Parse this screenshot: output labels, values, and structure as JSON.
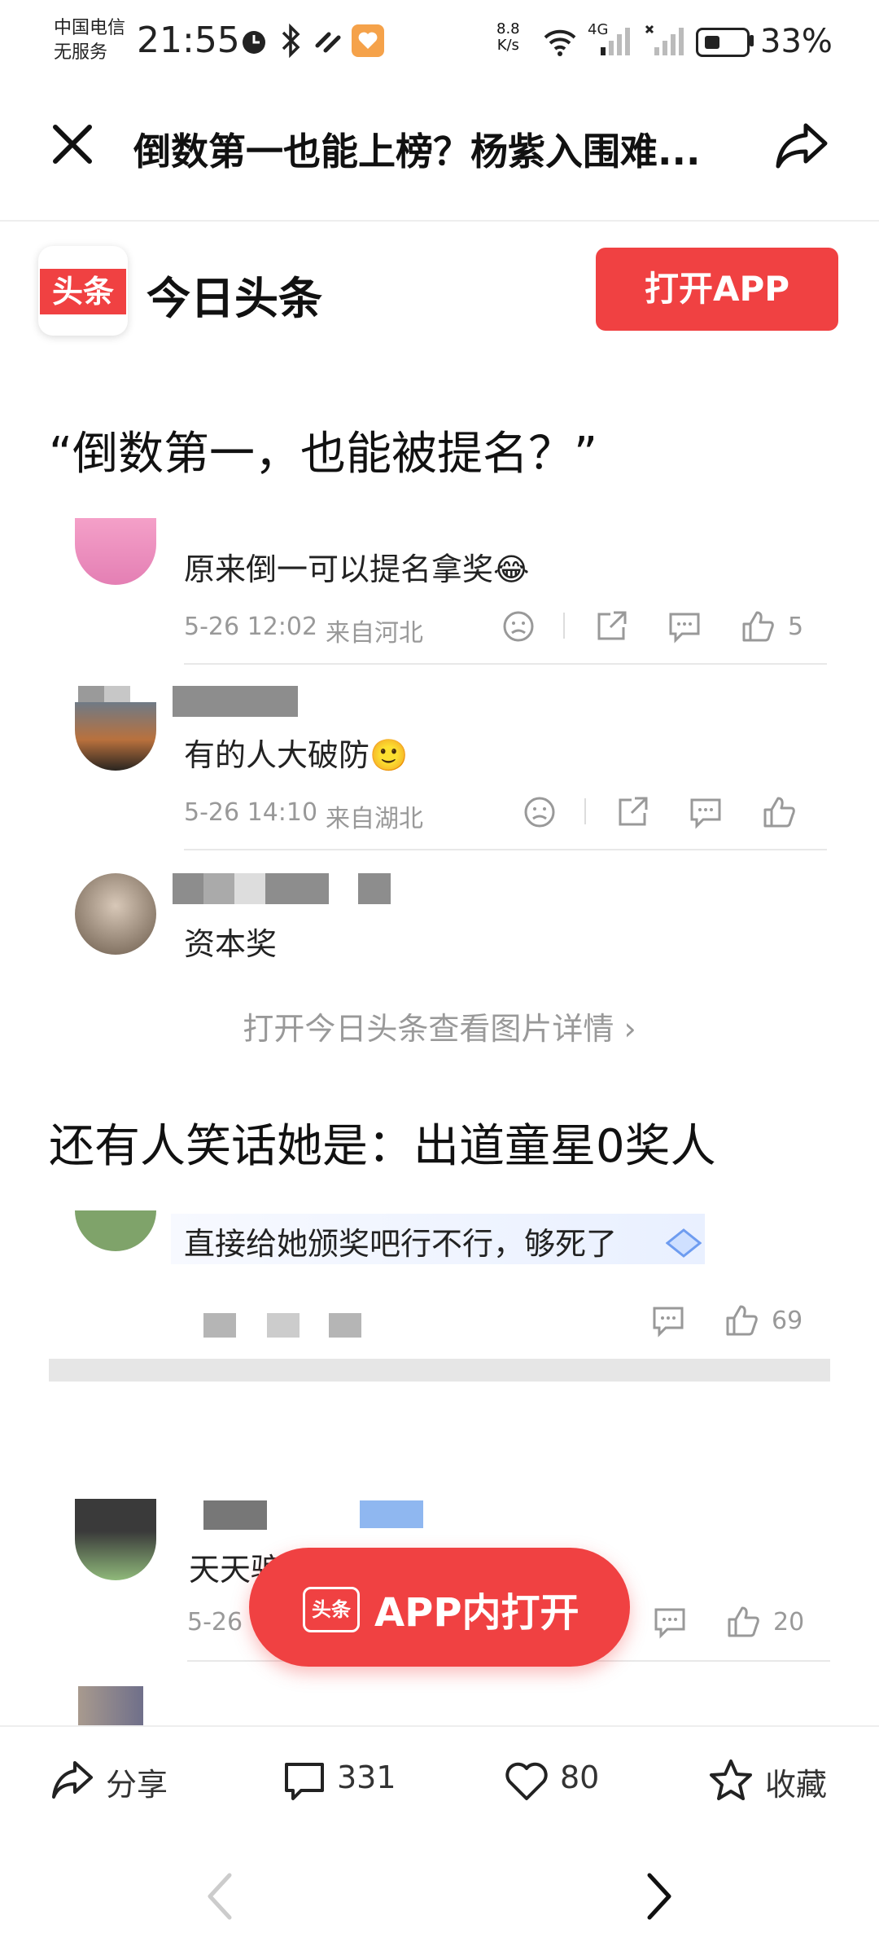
{
  "status_bar": {
    "carrier_line1": "中国电信",
    "carrier_line2": "无服务",
    "time": "21:55",
    "net_speed_value": "8.8",
    "net_speed_unit": "K/s",
    "network": "4G",
    "battery_percent": "33%",
    "battery_level": 0.33
  },
  "nav": {
    "title": "倒数第一也能上榜？杨紫入围难..."
  },
  "app_banner": {
    "logo_text": "头条",
    "app_name": "今日头条",
    "open_button": "打开APP"
  },
  "section1": {
    "heading": "“倒数第一，也能被提名？”",
    "comments": [
      {
        "text": "原来倒一可以提名拿奖😂",
        "time": "5-26 12:02",
        "location": "来自河北",
        "likes": "5"
      },
      {
        "text": "有的人大破防🙂",
        "time": "5-26 14:10",
        "location": "来自湖北",
        "likes": ""
      },
      {
        "text": "资本奖"
      }
    ],
    "view_more": "打开今日头条查看图片详情 ›"
  },
  "section2": {
    "heading": "还有人笑话她是：出道童星0奖人",
    "comment_text": "直接给她颁奖吧行不行，够死了",
    "likes": "69"
  },
  "section3": {
    "comment_text": "天天骗",
    "time_partial": "5-26",
    "likes": "20"
  },
  "floating_button": {
    "logo_text": "头条",
    "label": "APP内打开"
  },
  "bottom_bar": {
    "share": "分享",
    "comments": "331",
    "likes": "80",
    "collect": "收藏"
  },
  "colors": {
    "brand_red": "#f04142",
    "meta_gray": "#999999",
    "divider": "#e8e8e8"
  }
}
